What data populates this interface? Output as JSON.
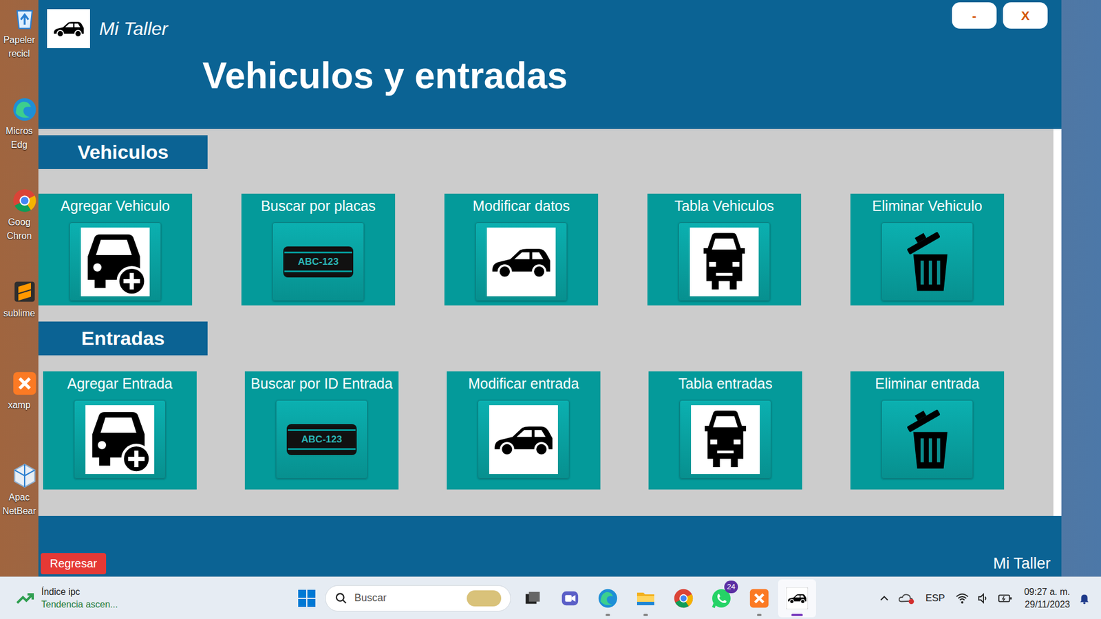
{
  "desktop_icons": [
    {
      "kind": "recycle",
      "lines": [
        "Papeler",
        "recicl"
      ]
    },
    {
      "kind": "edge",
      "lines": [
        "Micros",
        "Edg"
      ]
    },
    {
      "kind": "chrome",
      "lines": [
        "Goog",
        "Chron"
      ]
    },
    {
      "kind": "sublime",
      "lines": [
        "sublime"
      ]
    },
    {
      "kind": "xampp",
      "lines": [
        "xamp"
      ]
    },
    {
      "kind": "netbeans",
      "lines": [
        "Apac",
        "NetBear"
      ]
    }
  ],
  "window": {
    "title": "Mi Taller",
    "heading": "Vehiculos y entradas",
    "controls": [
      "-",
      "X"
    ]
  },
  "sections": [
    {
      "title": "Vehiculos",
      "cards": [
        {
          "label": "Agregar Vehiculo",
          "kind": "add"
        },
        {
          "label": "Buscar por placas",
          "kind": "plate",
          "plate": "ABC-123"
        },
        {
          "label": "Modificar datos",
          "kind": "edit"
        },
        {
          "label": "Tabla Vehiculos",
          "kind": "table"
        },
        {
          "label": "Eliminar Vehiculo",
          "kind": "delete"
        }
      ]
    },
    {
      "title": "Entradas",
      "cards": [
        {
          "label": "Agregar Entrada",
          "kind": "add"
        },
        {
          "label": "Buscar por ID Entrada",
          "kind": "plate",
          "plate": "ABC-123"
        },
        {
          "label": "Modificar entrada",
          "kind": "edit"
        },
        {
          "label": "Tabla entradas",
          "kind": "table"
        },
        {
          "label": "Eliminar entrada",
          "kind": "delete"
        }
      ]
    }
  ],
  "footer": {
    "back_button": "Regresar",
    "brand": "Mi Taller"
  },
  "taskbar": {
    "widget": {
      "title": "Índice ipc",
      "subtitle": "Tendencia ascen..."
    },
    "search": {
      "placeholder": "Buscar"
    },
    "apps": [
      {
        "kind": "taskview",
        "running": false,
        "selected": false
      },
      {
        "kind": "chat",
        "running": false,
        "selected": false
      },
      {
        "kind": "edge",
        "running": true,
        "selected": false
      },
      {
        "kind": "explorer",
        "running": true,
        "selected": false
      },
      {
        "kind": "chrome",
        "running": false,
        "selected": false
      },
      {
        "kind": "whatsapp",
        "running": false,
        "selected": false,
        "badge": "24"
      },
      {
        "kind": "xampp",
        "running": true,
        "selected": false
      },
      {
        "kind": "taller",
        "running": true,
        "selected": true
      }
    ],
    "tray": {
      "language": "ESP",
      "time": "09:27 a. m.",
      "date": "29/11/2023"
    }
  }
}
